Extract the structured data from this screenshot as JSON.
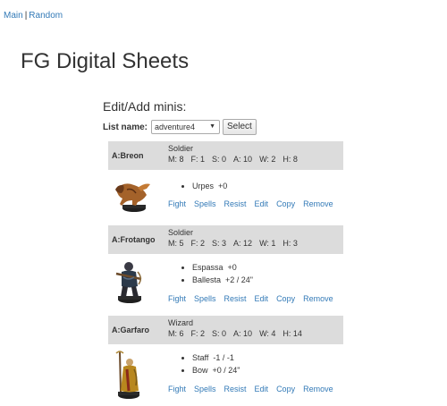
{
  "nav": {
    "main": "Main",
    "sep": "|",
    "random": "Random"
  },
  "site_title": "FG Digital Sheets",
  "section_title": "Edit/Add minis:",
  "list": {
    "label": "List name:",
    "selected": "adventure4",
    "select_button": "Select"
  },
  "actions": [
    "Fight",
    "Spells",
    "Resist",
    "Edit",
    "Copy",
    "Remove"
  ],
  "minis": [
    {
      "name": "A:Breon",
      "class": "Soldier",
      "stats": [
        "M: 8",
        "F: 1",
        "S: 0",
        "A: 10",
        "W: 2",
        "H: 8"
      ],
      "items": [
        {
          "name": "Urpes",
          "value": "+0"
        }
      ],
      "icon": "lion-beast-miniature"
    },
    {
      "name": "A:Frotango",
      "class": "Soldier",
      "stats": [
        "M: 5",
        "F: 2",
        "S: 3",
        "A: 12",
        "W: 1",
        "H: 3"
      ],
      "items": [
        {
          "name": "Espassa",
          "value": "+0"
        },
        {
          "name": "Ballesta",
          "value": "+2 / 24\""
        }
      ],
      "icon": "crossbowman-miniature"
    },
    {
      "name": "A:Garfaro",
      "class": "Wizard",
      "stats": [
        "M: 6",
        "F: 2",
        "S: 0",
        "A: 10",
        "W: 4",
        "H: 14"
      ],
      "items": [
        {
          "name": "Staff",
          "value": "-1 / -1"
        },
        {
          "name": "Bow",
          "value": "+0 / 24\""
        }
      ],
      "icon": "wizard-miniature"
    }
  ]
}
